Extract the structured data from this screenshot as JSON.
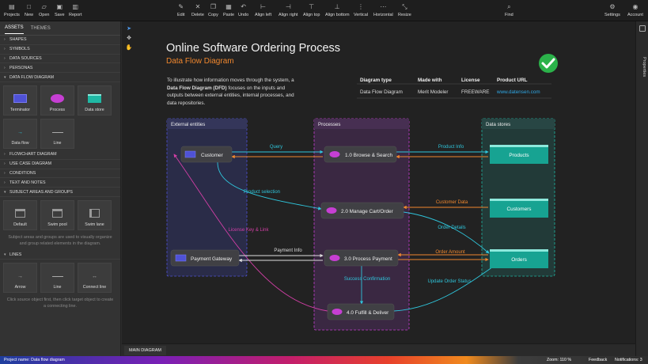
{
  "toolbar": {
    "left": [
      {
        "id": "projects",
        "label": "Projects",
        "icon": "projects-icon",
        "glyph": "▤"
      },
      {
        "id": "new",
        "label": "New",
        "icon": "new-icon",
        "glyph": "□"
      },
      {
        "id": "open",
        "label": "Open",
        "icon": "open-icon",
        "glyph": "▱"
      },
      {
        "id": "save",
        "label": "Save",
        "icon": "save-icon",
        "glyph": "▣"
      },
      {
        "id": "report",
        "label": "Report",
        "icon": "report-icon",
        "glyph": "▥"
      }
    ],
    "center": [
      {
        "id": "edit",
        "label": "Edit",
        "icon": "edit-icon",
        "glyph": "✎"
      },
      {
        "id": "delete",
        "label": "Delete",
        "icon": "delete-icon",
        "glyph": "✕"
      },
      {
        "id": "copy",
        "label": "Copy",
        "icon": "copy-icon",
        "glyph": "❐"
      },
      {
        "id": "paste",
        "label": "Paste",
        "icon": "paste-icon",
        "glyph": "▦"
      },
      {
        "id": "undo",
        "label": "Undo",
        "icon": "undo-icon",
        "glyph": "↶"
      },
      {
        "id": "align-left",
        "label": "Align left",
        "icon": "align-left-icon",
        "glyph": "⊢"
      },
      {
        "id": "align-right",
        "label": "Align right",
        "icon": "align-right-icon",
        "glyph": "⊣"
      },
      {
        "id": "align-top",
        "label": "Align top",
        "icon": "align-top-icon",
        "glyph": "⊤"
      },
      {
        "id": "align-bottom",
        "label": "Align bottom",
        "icon": "align-bottom-icon",
        "glyph": "⊥"
      },
      {
        "id": "vertical",
        "label": "Vertical",
        "icon": "vertical-icon",
        "glyph": "⋮"
      },
      {
        "id": "horizontal",
        "label": "Horizontal",
        "icon": "horizontal-icon",
        "glyph": "⋯"
      },
      {
        "id": "resize",
        "label": "Resize",
        "icon": "resize-icon",
        "glyph": "⤡"
      }
    ],
    "find": {
      "label": "Find",
      "icon": "search-icon",
      "glyph": "⌕"
    },
    "settings": {
      "label": "Settings",
      "icon": "gear-icon",
      "glyph": "⚙"
    },
    "account": {
      "label": "Account",
      "icon": "account-icon",
      "glyph": "◉"
    }
  },
  "left_panel": {
    "tabs": [
      "ASSETS",
      "THEMES"
    ],
    "sections_top": [
      "SHAPES",
      "SYMBOLS",
      "DATA SOURCES",
      "PERSONAS"
    ],
    "dfd_section": "DATA FLOW DIAGRAM",
    "dfd_tiles": [
      "Terminator",
      "Process",
      "Data store",
      "Data flow",
      "Line"
    ],
    "sections_mid": [
      "FLOWCHART DIAGRAM",
      "USE CASE DIAGRAM",
      "CONDITIONS",
      "TEXT AND NOTES"
    ],
    "subject_section": "SUBJECT AREAS AND GROUPS",
    "subject_tiles": [
      "Default",
      "Swim pool",
      "Swim lane"
    ],
    "subject_hint": "Subject areas and groups are used to visually organize and group related elements in the diagram.",
    "lines_section": "LINES",
    "line_tiles": [
      "Arrow",
      "Line",
      "Connect line"
    ],
    "lines_hint": "Click source object first, then click target object to create a connecting line."
  },
  "diagram": {
    "title": "Online Software Ordering Process",
    "subtitle": "Data Flow Diagram",
    "description_1": "To illustrate how information moves through the system, a",
    "description_bold": "Data Flow Diagram (DFD)",
    "description_2": " focuses on the inputs and",
    "description_3": "outputs between external entities, internal processes, and",
    "description_4": "data repositories.",
    "info_table": {
      "headers": [
        "Diagram type",
        "Made with",
        "License",
        "Product URL"
      ],
      "row": [
        "Data Flow Diagram",
        "Merit Modeler",
        "FREEWARE",
        "www.datensen.com"
      ]
    },
    "groups": {
      "external": "External entities",
      "processes": "Processes",
      "stores": "Data stores"
    },
    "entities": [
      "Customer",
      "Payment Gateway"
    ],
    "processes": [
      "1.0 Browse & Search",
      "2.0 Manage Cart/Order",
      "3.0 Process Payment",
      "4.0 Fulfill & Deliver"
    ],
    "stores": [
      "Products",
      "Customers",
      "Orders"
    ],
    "flows": {
      "query": "Query",
      "product_info": "Product Info",
      "product_selection": "Product selection",
      "customer_data": "Customer Data",
      "order_details": "Order Details",
      "license_key": "License Key & Link",
      "payment_info": "Payment Info",
      "order_amount": "Order Amount",
      "success_confirmation": "Success Confirmation",
      "update_order_status": "Update Order Status"
    },
    "colors": {
      "external": "#4f52d6",
      "process": "#c63fd3",
      "store": "#1fb8a4",
      "cyan_flow": "#2fc6dc",
      "orange_flow": "#f0872e",
      "pink_flow": "#d23fa6",
      "check": "#2bb24a"
    }
  },
  "right_panel": {
    "label": "Properties"
  },
  "page_tabs": [
    "MAIN DIAGRAM"
  ],
  "status": {
    "project": "Project name: Data flow diagram",
    "zoom": "Zoom: 110 %",
    "feedback": "Feedback",
    "notifications": "Notifications: 3"
  }
}
